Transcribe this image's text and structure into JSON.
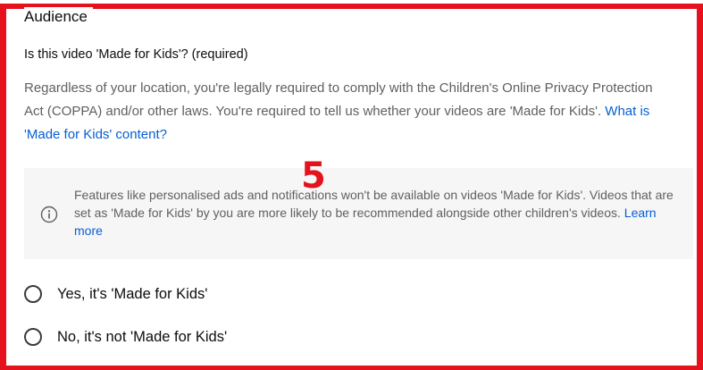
{
  "section": {
    "title": "Audience"
  },
  "question": "Is this video 'Made for Kids'? (required)",
  "description": {
    "text": "Regardless of your location, you're legally required to comply with the Children's Online Privacy Protection Act (COPPA) and/or other laws. You're required to tell us whether your videos are 'Made for Kids'. ",
    "link": "What is 'Made for Kids' content?"
  },
  "info": {
    "icon": "info-icon",
    "text": "Features like personalised ads and notifications won't be available on videos 'Made for Kids'. Videos that are set as 'Made for Kids' by you are more likely to be recommended alongside other children's videos. ",
    "link": "Learn more"
  },
  "options": [
    {
      "label": "Yes, it's 'Made for Kids'",
      "selected": false
    },
    {
      "label": "No, it's not 'Made for Kids'",
      "selected": false
    }
  ],
  "annotation": {
    "number": "5",
    "color": "#e5121e"
  },
  "colors": {
    "link": "#065fd4",
    "secondary_text": "#606060",
    "primary_text": "#0d0d0d",
    "info_background": "#f6f6f6"
  }
}
